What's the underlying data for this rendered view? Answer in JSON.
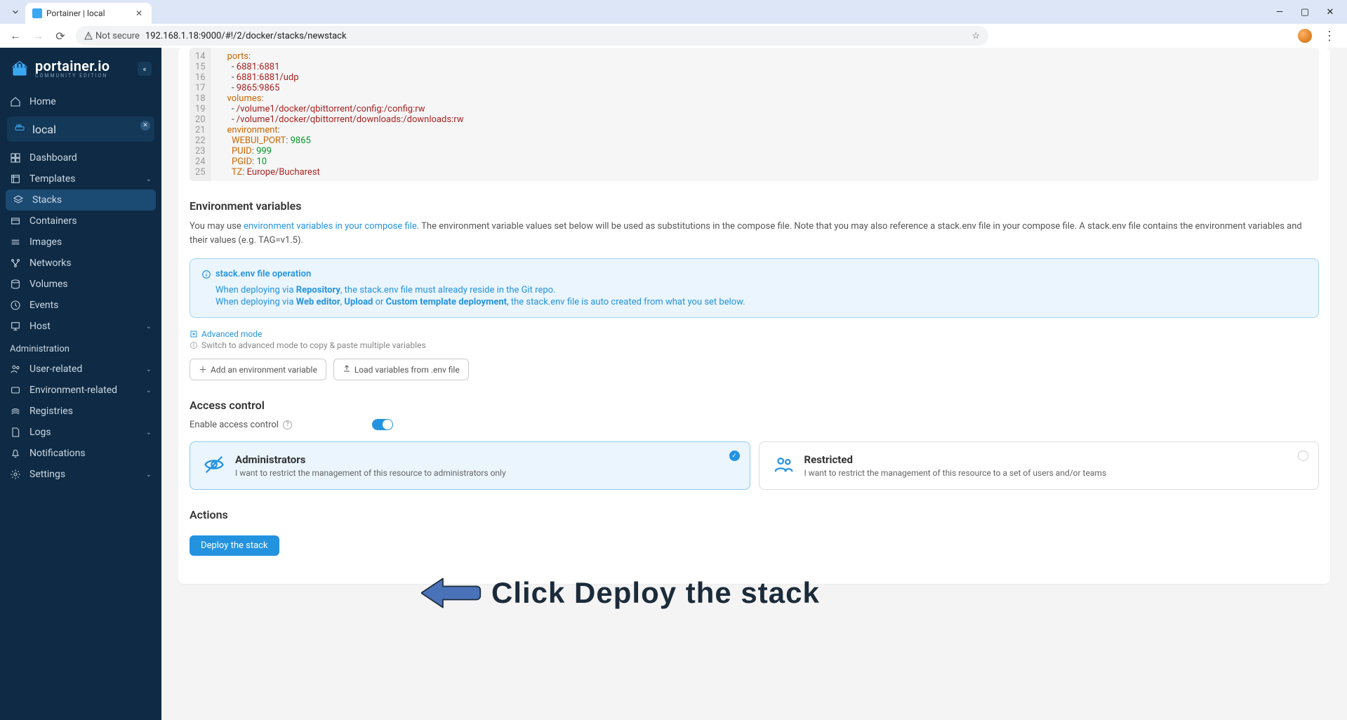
{
  "browser": {
    "tab_title": "Portainer | local",
    "not_secure_label": "Not secure",
    "url": "192.168.1.18:9000/#!/2/docker/stacks/newstack"
  },
  "logo": {
    "text": "portainer.io",
    "sub": "COMMUNITY EDITION"
  },
  "nav": {
    "home": "Home",
    "env_name": "local",
    "items": {
      "dashboard": "Dashboard",
      "templates": "Templates",
      "stacks": "Stacks",
      "containers": "Containers",
      "images": "Images",
      "networks": "Networks",
      "volumes": "Volumes",
      "events": "Events",
      "host": "Host"
    },
    "admin_header": "Administration",
    "admin": {
      "user_related": "User-related",
      "env_related": "Environment-related",
      "registries": "Registries",
      "logs": "Logs",
      "notifications": "Notifications",
      "settings": "Settings"
    }
  },
  "editor": {
    "line_start": 14,
    "lines": [
      {
        "indent": "    ",
        "k": "ports",
        "rest": ":"
      },
      {
        "indent": "      - ",
        "s": "6881:6881"
      },
      {
        "indent": "      - ",
        "s": "6881:6881/udp"
      },
      {
        "indent": "      - ",
        "s": "9865:9865"
      },
      {
        "indent": "    ",
        "k": "volumes",
        "rest": ":"
      },
      {
        "indent": "      - ",
        "s": "/volume1/docker/qbittorrent/config:/config:rw"
      },
      {
        "indent": "      - ",
        "s": "/volume1/docker/qbittorrent/downloads:/downloads:rw"
      },
      {
        "indent": "    ",
        "k": "environment",
        "rest": ":"
      },
      {
        "indent": "      ",
        "k": "WEBUI_PORT",
        "rest": ": ",
        "n": "9865"
      },
      {
        "indent": "      ",
        "k": "PUID",
        "rest": ": ",
        "n": "999"
      },
      {
        "indent": "      ",
        "k": "PGID",
        "rest": ": ",
        "n": "10"
      },
      {
        "indent": "      ",
        "k": "TZ",
        "rest": ": ",
        "s2": "Europe/Bucharest"
      }
    ]
  },
  "env_section": {
    "title": "Environment variables",
    "desc_pre": "You may use ",
    "desc_link": "environment variables in your compose file",
    "desc_post": ". The environment variable values set below will be used as substitutions in the compose file. Note that you may also reference a stack.env file in your compose file. A stack.env file contains the environment variables and their values (e.g. TAG=v1.5).",
    "info_title": "stack.env file operation",
    "info_l1_a": "When deploying via ",
    "info_l1_b": "Repository",
    "info_l1_c": ", the stack.env file must already reside in the Git repo.",
    "info_l2_a": "When deploying via ",
    "info_l2_b": "Web editor",
    "info_l2_c": ", ",
    "info_l2_d": "Upload",
    "info_l2_e": " or ",
    "info_l2_f": "Custom template deployment",
    "info_l2_g": ", the stack.env file is auto created from what you set below.",
    "adv_mode": "Advanced mode",
    "adv_hint": "Switch to advanced mode to copy & paste multiple variables",
    "btn_add": "Add an environment variable",
    "btn_load": "Load variables from .env file"
  },
  "access": {
    "title": "Access control",
    "enable_label": "Enable access control",
    "admin_title": "Administrators",
    "admin_desc": "I want to restrict the management of this resource to administrators only",
    "restr_title": "Restricted",
    "restr_desc": "I want to restrict the management of this resource to a set of users and/or teams"
  },
  "actions": {
    "title": "Actions",
    "deploy_label": "Deploy the stack"
  },
  "annotation": "Click Deploy the stack"
}
